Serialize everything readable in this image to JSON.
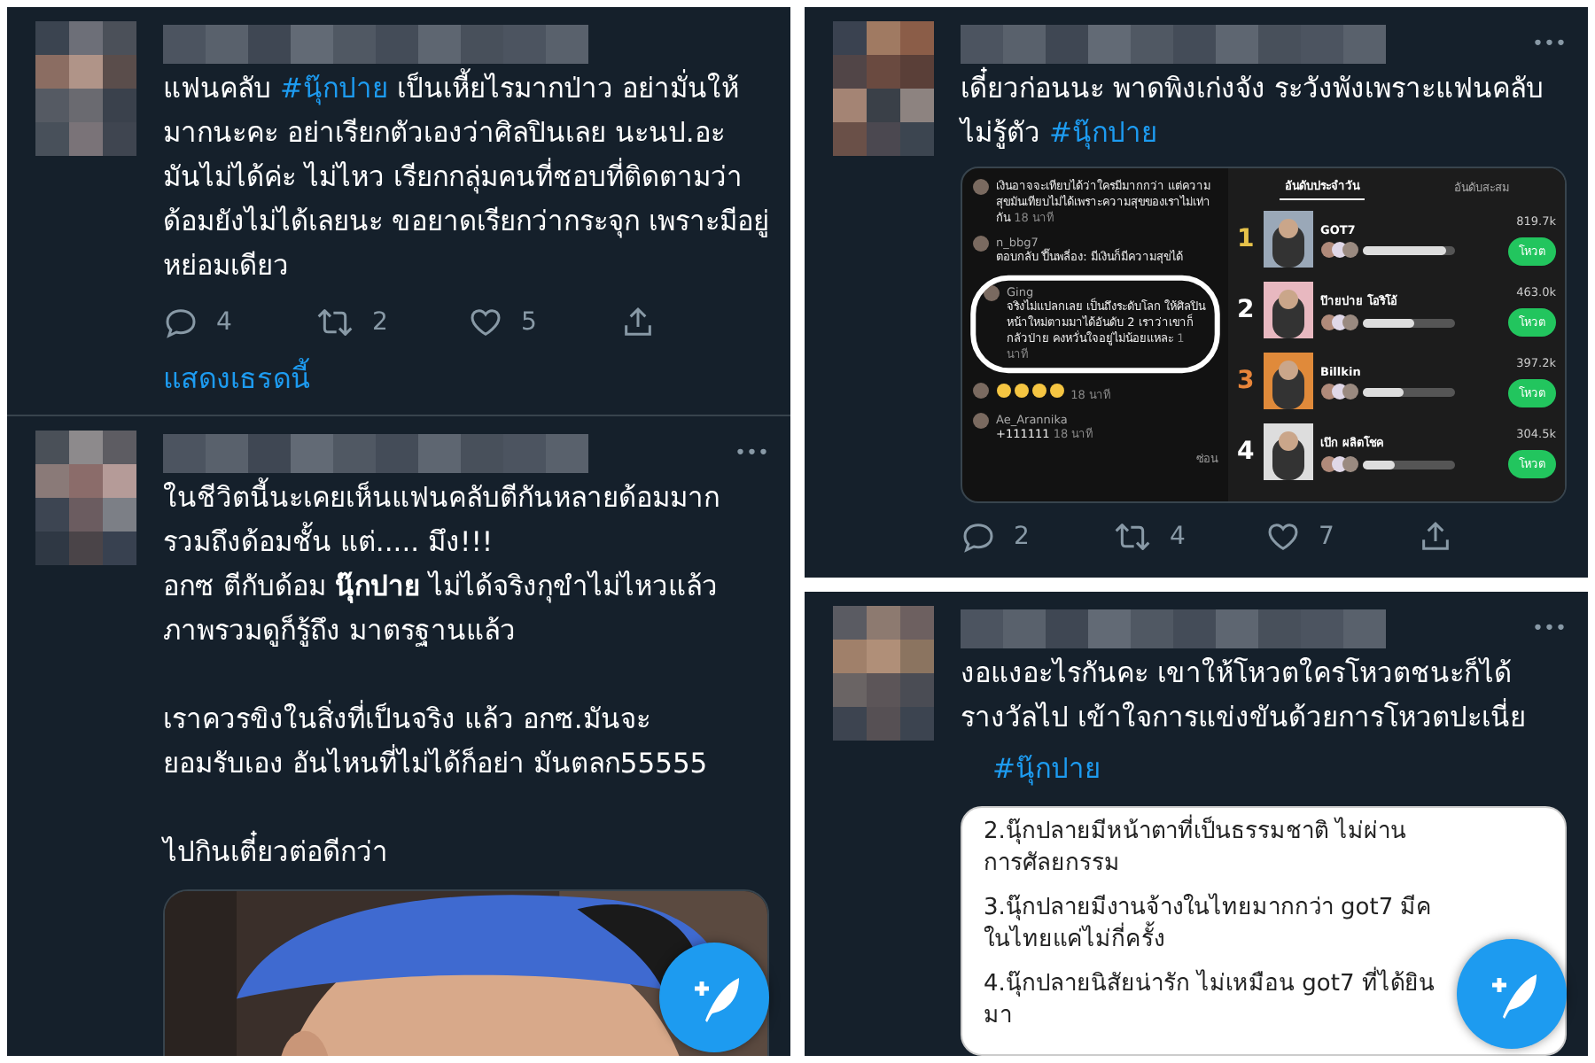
{
  "columns": [
    {
      "tweets": [
        {
          "paragraphs": [
            {
              "runs": [
                {
                  "kind": "text",
                  "text": "แฟนคลับ "
                },
                {
                  "kind": "hashtag",
                  "text": "#นุ๊กปาย"
                },
                {
                  "kind": "text",
                  "text": " เป็นเหี้ยไรมากป่าว อย่ามั่นให้มากนะคะ อย่าเรียกตัวเองว่าศิลปินเลย นะนป.อะ มันไม่ได้ค่ะ ไม่ไหว เรียกกลุ่มคนที่ชอบที่ติดตามว่าด้อมยังไม่ได้เลยนะ ขอยาดเรียกว่ากระจุก เพราะมีอยู่หย่อมเดียว"
                }
              ]
            }
          ],
          "actions": {
            "reply": "4",
            "retweet": "2",
            "like": "5"
          },
          "thread_link": "แสดงเธรดนี้"
        },
        {
          "more_menu": "•••",
          "paragraphs": [
            {
              "runs": [
                {
                  "kind": "text",
                  "text": "ในชีวิตนี้นะเคยเห็นแฟนคลับตีกันหลายด้อมมาก รวมถึงด้อมชั้น แต่..... มึง!!!\nอกซ ตีกับด้อม **นุ๊กปาย** ไม่ได้จริงกุขำไม่ไหวแล้ว\nภาพรวมดูก็รู้ถึง มาตรฐานแล้ว\n\nเราควรขิงในสิ่งที่เป็นจริง แล้ว อกซ.มันจะ\nยอมรับเอง อันไหนที่ไม่ได้ก็อย่า มันตลก55555\n\nไปกินเตี๋ยวต่อดีกว่า"
                }
              ]
            }
          ],
          "media": {
            "kind": "picture"
          }
        }
      ]
    },
    {
      "tweets": [
        {
          "more_menu": "•••",
          "paragraphs": [
            {
              "runs": [
                {
                  "kind": "text",
                  "text": "เดี๋ยวก่อนนะ พาดพิงเก่งจัง ระวังพังเพราะแฟนคลับไม่รู้ตัว  "
                },
                {
                  "kind": "hashtag",
                  "text": "#นุ๊กปาย"
                }
              ]
            }
          ],
          "media": {
            "kind": "app_screenshot",
            "comments": [
              {
                "kind": "text",
                "text": "เงินอาจจะเทียบได้ว่าใครมีมากกว่า แต่ความสุขมันเทียบไม่ได้เพราะความสุขของเราไม่เท่ากัน",
                "time": "18 นาที",
                "highlighted": false
              },
              {
                "kind": "text",
                "name": "n_bbg7",
                "text": "ตอบกลับ ปึ๊นพลี่อง: มีเงินก็มีความสุขได้",
                "highlighted": false
              },
              {
                "kind": "text",
                "name": "Ging",
                "text": "จริงไม่แปลกเลย เป็นถึงระดับโลก ให้ศิลปินหน้าใหม่ตามมาได้อันดับ 2 เราว่าเขาก็กลัวป่าย คงหวั่นใจอยู่ไม่น้อยแหละ",
                "time": "1 นาที",
                "highlighted": true
              },
              {
                "kind": "emoji",
                "time": "18 นาที",
                "highlighted": false
              },
              {
                "kind": "text",
                "name": "Ae_Arannika",
                "text": "+111111",
                "time": "18 นาที",
                "highlighted": false
              }
            ],
            "hide_link": "ซ่อน",
            "tabs": [
              {
                "label": "อันดับประจำวัน",
                "selected": true
              },
              {
                "label": "อันดับสะสม",
                "selected": false
              }
            ],
            "ranking": [
              {
                "rank": "1",
                "color": "#e6c24a",
                "name": "GOT7",
                "score": "819.7k",
                "level": 0.9,
                "vote": "โหวต"
              },
              {
                "rank": "2",
                "color": "#ffffff",
                "name": "ป๊ายปาย โอริโอ้",
                "score": "463.0k",
                "level": 0.55,
                "vote": "โหวต"
              },
              {
                "rank": "3",
                "color": "#e8853a",
                "name": "Billkin",
                "score": "397.2k",
                "level": 0.45,
                "vote": "โหวต"
              },
              {
                "rank": "4",
                "color": "#ffffff",
                "name": "เป๊ก ผลิตโชค",
                "score": "304.5k",
                "level": 0.35,
                "vote": "โหวต"
              }
            ]
          },
          "actions": {
            "reply": "2",
            "retweet": "4",
            "like": "7"
          }
        },
        {
          "more_menu": "•••",
          "paragraphs": [
            {
              "runs": [
                {
                  "kind": "text",
                  "text": "งอแงอะไรกันคะ  เขาให้โหวตใครโหวตชนะก็ได้รางวัลไป เข้าใจการแข่งขันด้วยการโหวตปะเนี่ย"
                }
              ]
            },
            {
              "indent": true,
              "runs": [
                {
                  "kind": "hashtag",
                  "text": "#นุ๊กปาย"
                }
              ]
            }
          ],
          "media": {
            "kind": "text_card",
            "lines": [
              "2.นุ๊กปลายมีหน้าตาที่เป็นธรรมชาติ ไม่ผ่านการศัลยกรรม",
              "3.นุ๊กปลายมีงานจ้างในไทยมากกว่า got7 มีค\nในไทยแค่ไม่กี่ครั้ง",
              "4.นุ๊กปลายนิสัยน่ารัก ไม่เหมือน got7 ที่ได้ยินมา"
            ]
          }
        }
      ]
    }
  ]
}
